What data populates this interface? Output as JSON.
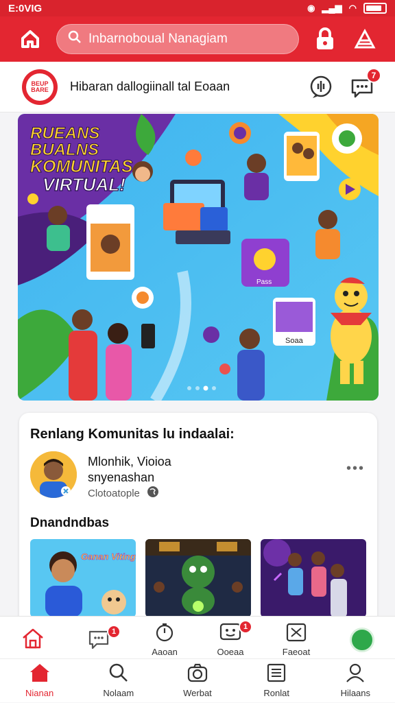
{
  "status": {
    "time": "E:0VIG",
    "icons": [
      "alarm-icon",
      "signal-icon",
      "wifi-icon",
      "battery-icon"
    ]
  },
  "topbar": {
    "search_placeholder": "Inbarnoboual Nanagiam"
  },
  "header": {
    "title": "Hibaran dallogiinall tal Eoaan",
    "logo_text": "BEUP BARE",
    "chat_badge": "7"
  },
  "banner": {
    "headline_lines": [
      "RUEANS",
      "BUALNS",
      "KOMUNITAS",
      "VIRTUAL!"
    ],
    "tile_label": "Soaa",
    "purple_tile_label": "Pass",
    "dots": 4,
    "active_dot": 2
  },
  "card": {
    "title": "Renlang Komunitas lu indaalai:",
    "user_name_line1": "Mlonhik, Vioioa",
    "user_name_line2": "snyenashan",
    "user_meta": "Clotoatople",
    "section_title": "Dnandndbas",
    "thumb1_label": "Ganan Vitings"
  },
  "bottom_row1": [
    {
      "label": "",
      "icon": "home-icon",
      "badge": ""
    },
    {
      "label": "",
      "icon": "chat-icon",
      "badge": "1"
    },
    {
      "label": "Aaoan",
      "icon": "timer-icon",
      "badge": ""
    },
    {
      "label": "Ooeaa",
      "icon": "face-icon",
      "badge": "1"
    },
    {
      "label": "Faeoat",
      "icon": "expand-icon",
      "badge": ""
    },
    {
      "label": "",
      "icon": "leaf-icon",
      "badge": ""
    }
  ],
  "bottom_row2": [
    {
      "label": "Nianan",
      "icon": "home-filled-icon",
      "active": true
    },
    {
      "label": "Nolaam",
      "icon": "search-icon",
      "active": false
    },
    {
      "label": "Werbat",
      "icon": "camera-icon",
      "active": false
    },
    {
      "label": "Ronlat",
      "icon": "list-icon",
      "active": false
    },
    {
      "label": "Hilaans",
      "icon": "user-icon",
      "active": false
    }
  ],
  "colors": {
    "brand": "#e32631",
    "green": "#2ea84a"
  }
}
